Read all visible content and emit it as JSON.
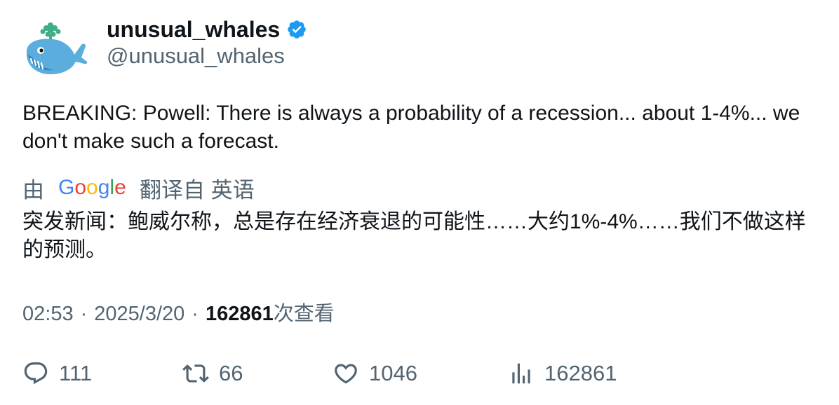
{
  "author": {
    "display_name": "unusual_whales",
    "handle": "@unusual_whales",
    "verified": true,
    "verified_color": "#1d9bf0",
    "avatar_icon": "whale-logo"
  },
  "tweet": {
    "text": "BREAKING: Powell: There is always a probability of a recession... about 1-4%... we don't make such a forecast."
  },
  "translation": {
    "prefix": "由",
    "provider": "Google",
    "suffix": "翻译自 英语",
    "text": "突发新闻：鲍威尔称，总是存在经济衰退的可能性……大约1%-4%……我们不做这样的预测。"
  },
  "meta": {
    "time": "02:53",
    "separator": "·",
    "date": "2025/3/20",
    "views_count": "162861",
    "views_label": "次查看"
  },
  "actions": {
    "replies": "111",
    "retweets": "66",
    "likes": "1046",
    "views": "162861"
  }
}
